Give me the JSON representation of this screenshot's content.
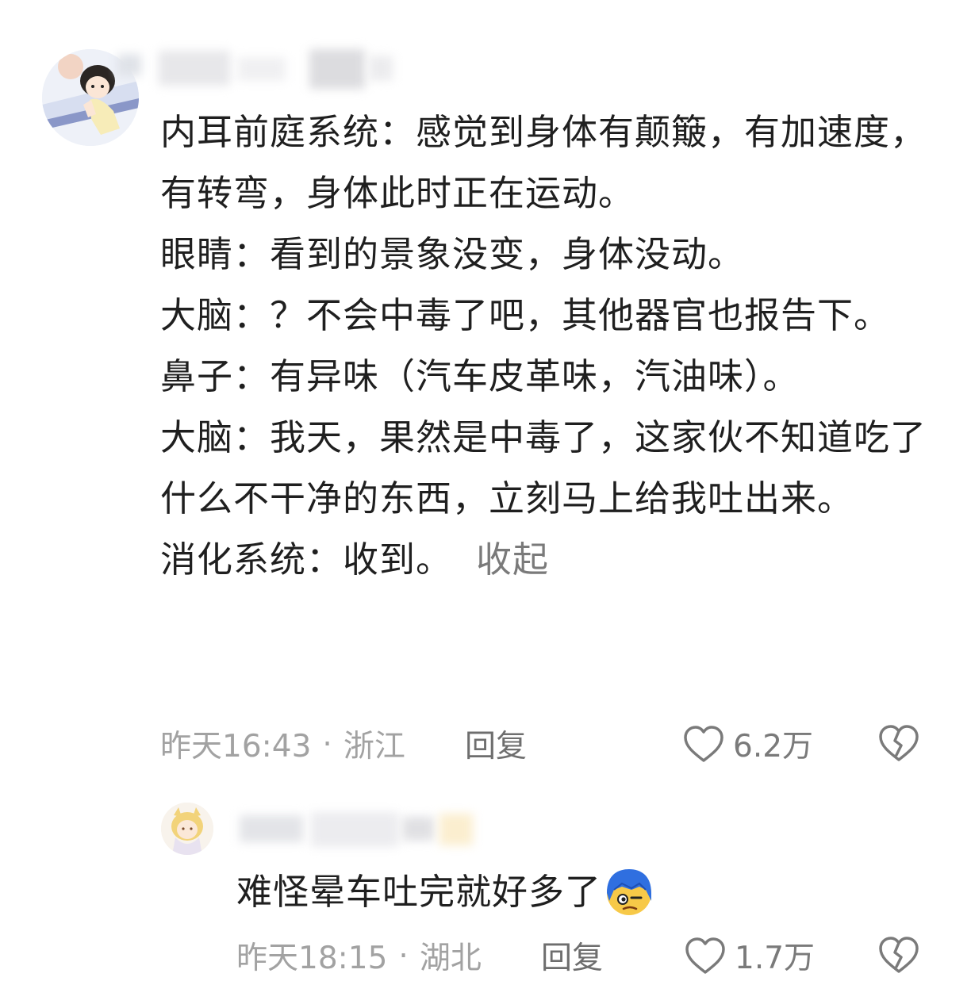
{
  "comment": {
    "lines": [
      "内耳前庭系统：感觉到身体有颠簸，有加速度，有转弯，身体此时正在运动。",
      "眼睛：看到的景象没变，身体没动。",
      "大脑：？不会中毒了吧，其他器官也报告下。",
      "鼻子：有异味（汽车皮革味，汽油味）。",
      "大脑：我天，果然是中毒了，这家伙不知道吃了什么不干净的东西，立刻马上给我吐出来。"
    ],
    "last_line": "消化系统：收到。",
    "collapse_label": "收起",
    "time": "昨天16:43",
    "separator": "·",
    "region": "浙江",
    "reply_label": "回复",
    "likes": "6.2万",
    "icons": {
      "avatar": "avatar-anime-boy",
      "like": "heart-outline-icon",
      "dislike": "broken-heart-icon"
    }
  },
  "reply": {
    "text": "难怪晕车吐完就好多了",
    "emoji": "blue-hair-face-emoji",
    "time": "昨天18:15",
    "separator": "·",
    "region": "湖北",
    "reply_label": "回复",
    "likes": "1.7万",
    "icons": {
      "avatar": "avatar-anime-blonde",
      "like": "heart-outline-icon",
      "dislike": "broken-heart-icon"
    }
  }
}
